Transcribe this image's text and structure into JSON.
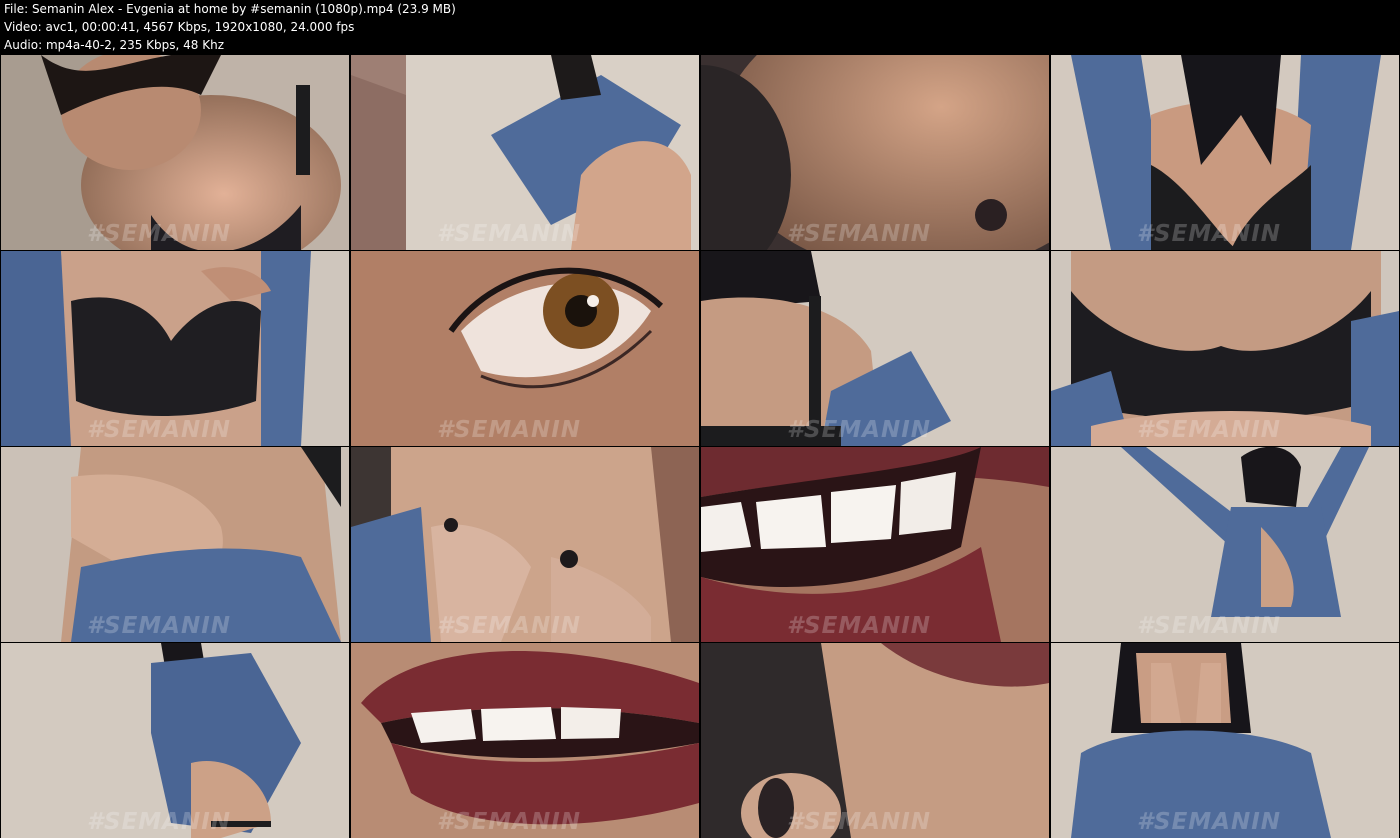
{
  "header": {
    "file_line": "File: Semanin Alex - Evgenia at home by #semanin (1080p).mp4 (23.9 MB)",
    "video_line": "Video: avc1, 00:00:41, 4567 Kbps, 1920x1080, 24.000 fps",
    "audio_line": "Audio: mp4a-40-2, 235 Kbps, 48 Khz"
  },
  "thumbnails": [
    {
      "watermark": "#SEMANIN"
    },
    {
      "watermark": "#SEMANIN"
    },
    {
      "watermark": "#SEMANIN"
    },
    {
      "watermark": "#SEMANIN"
    },
    {
      "watermark": "#SEMANIN"
    },
    {
      "watermark": "#SEMANIN"
    },
    {
      "watermark": "#SEMANIN"
    },
    {
      "watermark": "#SEMANIN"
    },
    {
      "watermark": "#SEMANIN"
    },
    {
      "watermark": "#SEMANIN"
    },
    {
      "watermark": "#SEMANIN"
    },
    {
      "watermark": "#SEMANIN"
    },
    {
      "watermark": "#SEMANIN"
    },
    {
      "watermark": "#SEMANIN"
    },
    {
      "watermark": "#SEMANIN"
    },
    {
      "watermark": "#SEMANIN"
    }
  ],
  "colors": {
    "background": "#000000",
    "header_text": "#ffffff",
    "wall_beige": "#cfc6bd",
    "skin": "#c9997e",
    "denim_blue": "#4f6b9a",
    "bra_black": "#1c1c1e",
    "lip_red": "#7a2c32"
  }
}
